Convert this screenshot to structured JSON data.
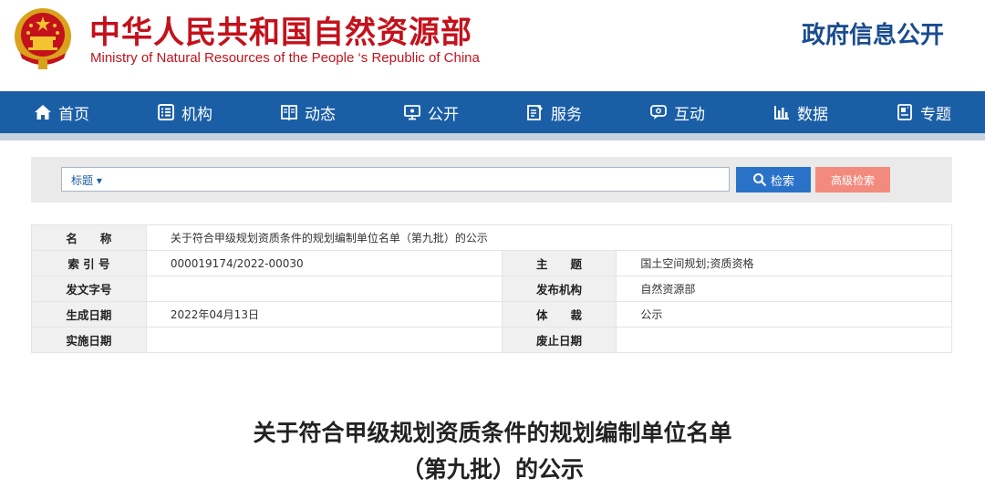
{
  "header": {
    "title_cn": "中华人民共和国自然资源部",
    "title_en": "Ministry of Natural Resources of the People ‘s Republic of China",
    "gov_info": "政府信息公开"
  },
  "nav": {
    "items": [
      {
        "label": "首页",
        "icon": "home-icon"
      },
      {
        "label": "机构",
        "icon": "list-icon"
      },
      {
        "label": "动态",
        "icon": "book-icon"
      },
      {
        "label": "公开",
        "icon": "monitor-icon"
      },
      {
        "label": "服务",
        "icon": "edit-icon"
      },
      {
        "label": "互动",
        "icon": "chat-icon"
      },
      {
        "label": "数据",
        "icon": "bar-chart-icon"
      },
      {
        "label": "专题",
        "icon": "document-icon"
      }
    ]
  },
  "search": {
    "type_label": "标题 ▾",
    "button_label": "检索",
    "advanced_label": "高级检索"
  },
  "meta": {
    "name_label": "名　　称",
    "name_value": "关于符合甲级规划资质条件的规划编制单位名单（第九批）的公示",
    "index_label": "索 引 号",
    "index_value": "000019174/2022-00030",
    "subject_label": "主　　题",
    "subject_value": "国土空间规划;资质资格",
    "docno_label": "发文字号",
    "docno_value": "",
    "publisher_label": "发布机构",
    "publisher_value": "自然资源部",
    "date_label": "生成日期",
    "date_value": "2022年04月13日",
    "genre_label": "体　　裁",
    "genre_value": "公示",
    "effective_label": "实施日期",
    "effective_value": "",
    "expiry_label": "废止日期",
    "expiry_value": ""
  },
  "article": {
    "title_line1": "关于符合甲级规划资质条件的规划编制单位名单",
    "title_line2": "（第九批）的公示"
  },
  "colors": {
    "brand_red": "#c3121c",
    "nav_blue": "#1a5ea6",
    "search_blue": "#2a72c8",
    "advanced_red": "#f28b7e"
  }
}
